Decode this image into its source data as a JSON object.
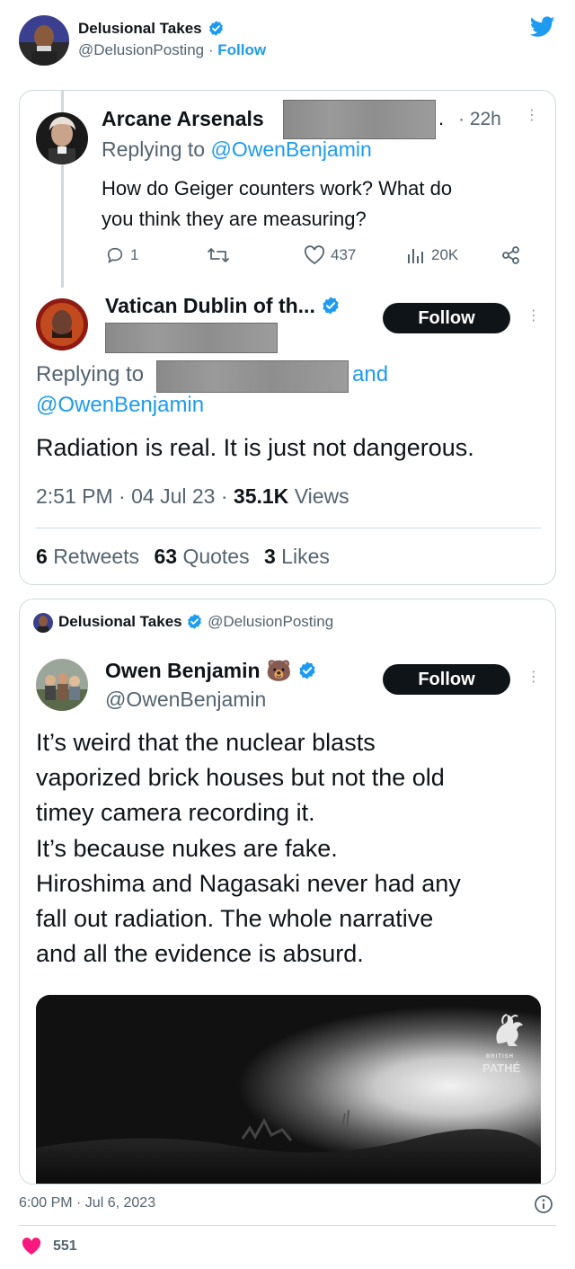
{
  "outer": {
    "display_name": "Delusional Takes",
    "handle": "@DelusionPosting",
    "separator": "·",
    "follow_label": "Follow",
    "timestamp": "6:00 PM · Jul 6, 2023",
    "like_count": "551"
  },
  "screenshot1": {
    "reply_tweet": {
      "display_name": "Arcane Arsenals",
      "name_trail": ".",
      "time": "· 22h",
      "replying_prefix": "Replying to",
      "replying_handle": "@OwenBenjamin",
      "text_line1": "How do Geiger counters work? What do",
      "text_line2": "you think they are measuring?",
      "replies": "1",
      "likes": "437",
      "views": "20K"
    },
    "main_tweet": {
      "display_name": "Vatican Dublin of th...",
      "follow_label": "Follow",
      "replying_prefix": "Replying to",
      "replying_and": "and",
      "replying_handle": "@OwenBenjamin",
      "text": "Radiation is real. It is just not dangerous.",
      "meta_time": "2:51 PM",
      "meta_date": "04 Jul 23",
      "meta_views_count": "35.1K",
      "meta_views_label": "Views",
      "meta_dot": "·",
      "retweets_count": "6",
      "retweets_label": "Retweets",
      "quotes_count": "63",
      "quotes_label": "Quotes",
      "likes_count": "3",
      "likes_label": "Likes"
    }
  },
  "quote": {
    "author_name": "Delusional Takes",
    "author_handle": "@DelusionPosting",
    "inner": {
      "display_name": "Owen Benjamin",
      "emoji": "🐻",
      "handle": "@OwenBenjamin",
      "follow_label": "Follow",
      "lines": [
        "It’s weird that the nuclear blasts",
        "vaporized brick houses but not the old",
        "timey camera recording it.",
        "It’s because nukes are fake.",
        "Hiroshima and Nagasaki never had any",
        "fall out radiation. The whole narrative",
        "and all the evidence is absurd."
      ],
      "video_watermark": "PATHÉ",
      "video_watermark_small": "BRITISH"
    }
  },
  "colors": {
    "twitter_blue": "#1d9bf0",
    "like_pink": "#f91880",
    "text": "#0f1419",
    "muted": "#536471"
  }
}
